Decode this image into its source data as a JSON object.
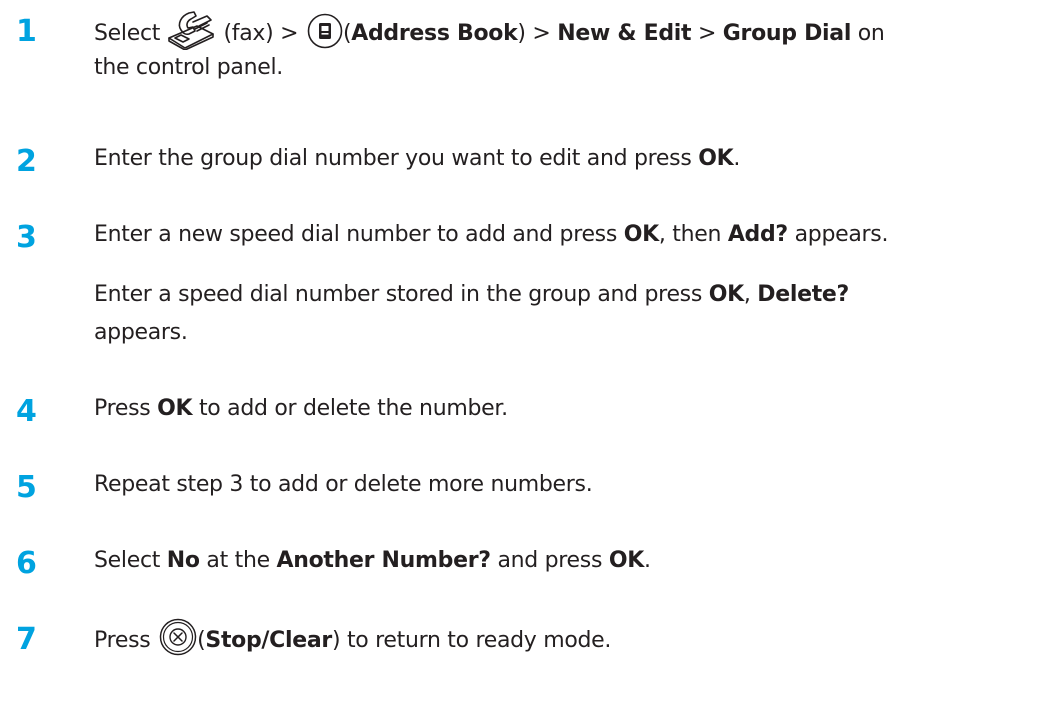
{
  "steps": [
    {
      "number": "1",
      "segments": {
        "select": "Select",
        "fax": "(fax) >",
        "open": "(",
        "address_book": "Address Book",
        "close_gt": ") >",
        "new_edit": "New & Edit",
        "gt": ">",
        "group_dial": "Group Dial",
        "on": "on",
        "line2": "the control panel."
      }
    },
    {
      "number": "2",
      "segments": {
        "text": "Enter the group dial number you want to edit and press",
        "ok": "OK",
        "period": "."
      }
    },
    {
      "number": "3",
      "segments": {
        "text1": "Enter a new speed dial number to add and press",
        "ok1": "OK",
        "then": ", then",
        "add": "Add?",
        "appears1": "appears.",
        "text2": "Enter a speed dial number stored in the group and press",
        "ok2": "OK",
        "comma": ",",
        "delete": "Delete?",
        "appears2": "appears."
      }
    },
    {
      "number": "4",
      "segments": {
        "press": "Press",
        "ok": "OK",
        "rest": "to add or delete the number."
      }
    },
    {
      "number": "5",
      "segments": {
        "text": "Repeat step 3 to add or delete more numbers."
      }
    },
    {
      "number": "6",
      "segments": {
        "select": "Select",
        "no": "No",
        "at_the": "at the",
        "another": "Another Number?",
        "and_press": "and press",
        "ok": "OK",
        "period": "."
      }
    },
    {
      "number": "7",
      "segments": {
        "press": "Press",
        "open": "(",
        "stop_clear": "Stop/Clear",
        "rest": ") to return to ready mode."
      }
    }
  ],
  "icons": {
    "fax": "fax-icon",
    "address_book": "address-book-icon",
    "stop_clear": "stop-clear-icon"
  },
  "colors": {
    "step_number": "#00a3e0",
    "text": "#231f20"
  }
}
